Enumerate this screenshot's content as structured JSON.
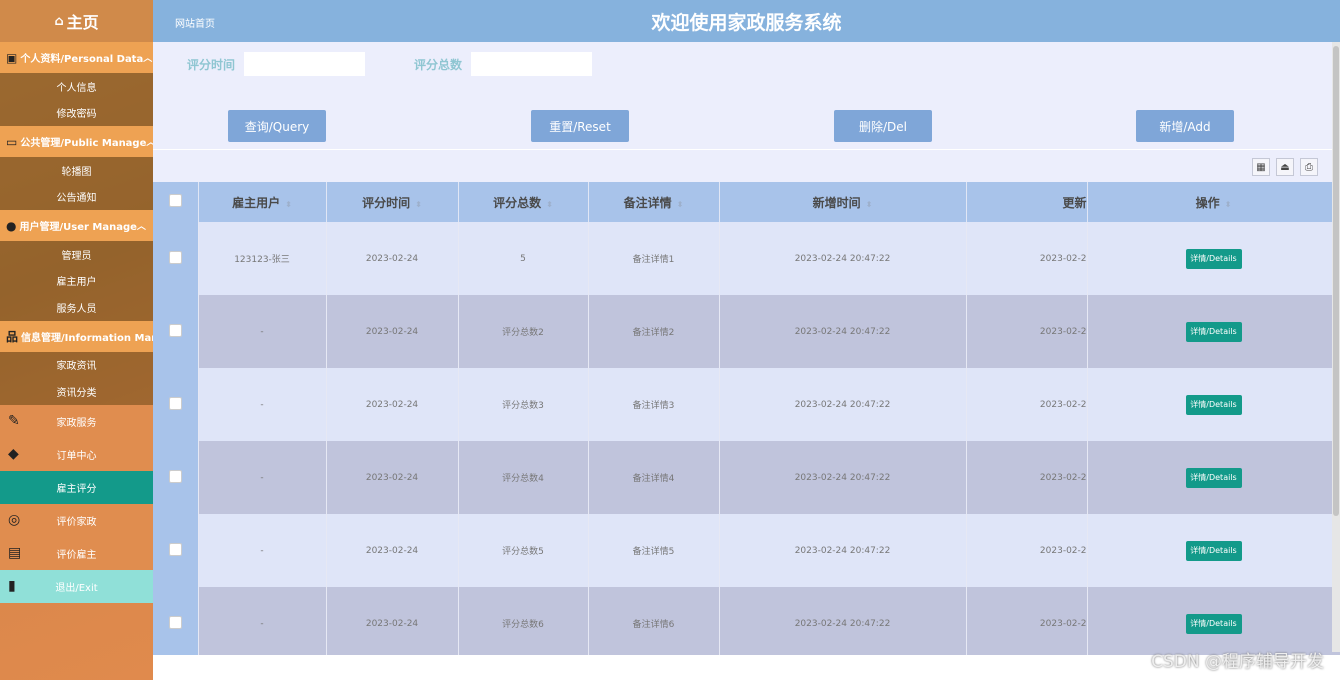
{
  "sidebar": {
    "home": "主页",
    "groups": [
      {
        "title": "个人资料/Personal Data",
        "icon": "person-card-icon",
        "items": [
          "个人信息",
          "修改密码"
        ]
      },
      {
        "title": "公共管理/Public Manage",
        "icon": "monitor-icon",
        "items": [
          "轮播图",
          "公告通知"
        ]
      },
      {
        "title": "用户管理/User Manage",
        "icon": "user-gear-icon",
        "items": [
          "管理员",
          "雇主用户",
          "服务人员"
        ]
      },
      {
        "title": "信息管理/Information Manage",
        "icon": "sitemap-icon",
        "items": [
          "家政资讯",
          "资讯分类"
        ]
      }
    ],
    "top_items": [
      {
        "label": "家政服务",
        "icon": "tools-icon"
      },
      {
        "label": "订单中心",
        "icon": "tag-icon"
      },
      {
        "label": "雇主评分",
        "icon": ""
      },
      {
        "label": "评价家政",
        "icon": "planet-icon"
      },
      {
        "label": "评价雇主",
        "icon": "laptop-icon"
      },
      {
        "label": "退出/Exit",
        "icon": "door-icon"
      }
    ]
  },
  "header": {
    "breadcrumb": "网站首页",
    "title": "欢迎使用家政服务系统"
  },
  "search": {
    "time_label": "评分时间",
    "total_label": "评分总数",
    "time_value": "",
    "total_value": ""
  },
  "buttons": {
    "query": "查询/Query",
    "reset": "重置/Reset",
    "delete": "删除/Del",
    "add": "新增/Add"
  },
  "table": {
    "columns": [
      "雇主用户",
      "评分时间",
      "评分总数",
      "备注详情",
      "新增时间",
      "更新",
      "操作"
    ],
    "rows": [
      {
        "user": "123123-张三",
        "time": "2023-02-24",
        "total": "5",
        "remark": "备注详情1",
        "created": "2023-02-24 20:47:22",
        "updated": "2023-02-2"
      },
      {
        "user": "-",
        "time": "2023-02-24",
        "total": "评分总数2",
        "remark": "备注详情2",
        "created": "2023-02-24 20:47:22",
        "updated": "2023-02-2"
      },
      {
        "user": "-",
        "time": "2023-02-24",
        "total": "评分总数3",
        "remark": "备注详情3",
        "created": "2023-02-24 20:47:22",
        "updated": "2023-02-2"
      },
      {
        "user": "-",
        "time": "2023-02-24",
        "total": "评分总数4",
        "remark": "备注详情4",
        "created": "2023-02-24 20:47:22",
        "updated": "2023-02-2"
      },
      {
        "user": "-",
        "time": "2023-02-24",
        "total": "评分总数5",
        "remark": "备注详情5",
        "created": "2023-02-24 20:47:22",
        "updated": "2023-02-2"
      },
      {
        "user": "-",
        "time": "2023-02-24",
        "total": "评分总数6",
        "remark": "备注详情6",
        "created": "2023-02-24 20:47:22",
        "updated": "2023-02-2"
      }
    ],
    "details_label": "详情/Details"
  },
  "watermark": "CSDN @程序辅导开发"
}
